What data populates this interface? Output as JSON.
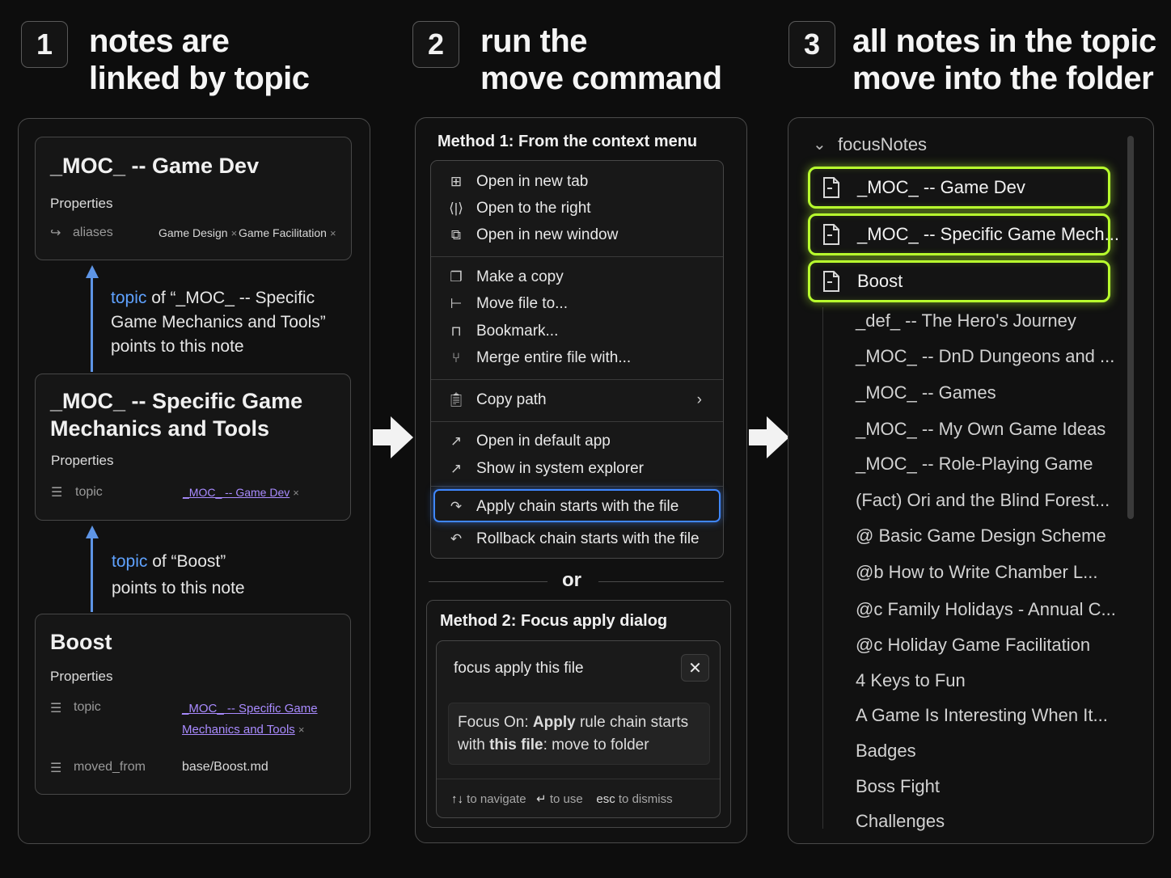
{
  "steps": [
    {
      "num": "1",
      "line1": "notes are",
      "line2": "linked by topic"
    },
    {
      "num": "2",
      "line1": "run the",
      "line2": "move command"
    },
    {
      "num": "3",
      "line1": "all notes in the topic",
      "line2": "move into the folder"
    }
  ],
  "panel1": {
    "card1": {
      "title": "_MOC_ -- Game Dev",
      "properties_label": "Properties",
      "prop_key": "aliases",
      "alias1": "Game Design",
      "alias2": "Game Facilitation",
      "remove": "×"
    },
    "note1": {
      "kw": "topic",
      "line1_rest": "of “_MOC_ -- Specific",
      "line2": "Game Mechanics and Tools”",
      "line3": "points to this note"
    },
    "card2": {
      "title_line1": "_MOC_ -- Specific Game",
      "title_line2": "Mechanics and Tools",
      "properties_label": "Properties",
      "prop_key": "topic",
      "prop_val": "_MOC_ -- Game Dev",
      "remove": "×"
    },
    "note2": {
      "kw": "topic",
      "line1_rest": "of “Boost”",
      "line2": "points to this note"
    },
    "card3": {
      "title": "Boost",
      "properties_label": "Properties",
      "prop1_key": "topic",
      "prop1_val_line1": "_MOC_ -- Specific Game",
      "prop1_val_line2": "Mechanics and Tools",
      "prop2_key": "moved_from",
      "prop2_val": "base/Boost.md",
      "remove": "×"
    }
  },
  "panel2": {
    "method1_title": "Method 1: From the context menu",
    "menu": [
      {
        "icon": "open-new-tab-icon",
        "label": "Open in new tab"
      },
      {
        "icon": "open-right-icon",
        "label": "Open to the right"
      },
      {
        "icon": "open-window-icon",
        "label": "Open in new window"
      },
      {
        "icon": "copy-icon",
        "label": "Make a copy"
      },
      {
        "icon": "move-file-icon",
        "label": "Move file to..."
      },
      {
        "icon": "bookmark-icon",
        "label": "Bookmark..."
      },
      {
        "icon": "merge-icon",
        "label": "Merge entire file with..."
      },
      {
        "icon": "clipboard-icon",
        "label": "Copy path"
      },
      {
        "icon": "external-link-icon",
        "label": "Open in default app"
      },
      {
        "icon": "external-link-icon",
        "label": "Show in system explorer"
      },
      {
        "icon": "redo-icon",
        "label": "Apply chain starts with the file"
      },
      {
        "icon": "undo-icon",
        "label": "Rollback chain starts with the file"
      }
    ],
    "or_label": "or",
    "method2_title": "Method 2: Focus apply dialog",
    "dialog": {
      "input_value": "focus apply this file",
      "close": "✕",
      "suggestion_p1": "Focus On: ",
      "suggestion_b1": "Apply",
      "suggestion_p2": " rule chain starts",
      "suggestion_p3": "with ",
      "suggestion_b2": "this file",
      "suggestion_p4": ": move to folder",
      "hint_nav_key": "↑↓",
      "hint_nav": "to navigate",
      "hint_use_key": "↵",
      "hint_use": "to use",
      "hint_esc_key": "esc",
      "hint_esc": "to dismiss"
    }
  },
  "panel3": {
    "folder": "focusNotes",
    "highlighted": [
      "_MOC_ -- Game Dev",
      "_MOC_ -- Specific Game Mech...",
      "Boost"
    ],
    "items": [
      "_def_ -- The Hero's Journey",
      "_MOC_ -- DnD Dungeons and ...",
      "_MOC_ -- Games",
      "_MOC_ -- My Own Game Ideas",
      "_MOC_ -- Role-Playing Game",
      "(Fact) Ori and the Blind Forest...",
      "@ Basic Game Design Scheme",
      "@b How to Write Chamber L...",
      "@c Family Holidays - Annual C...",
      "@c Holiday Game Facilitation",
      "4 Keys to Fun",
      "A Game Is Interesting When It...",
      "Badges",
      "Boss Fight",
      "Challenges"
    ]
  },
  "colors": {
    "highlight_green": "#b8ff2e",
    "highlight_blue": "#3f87ff",
    "link": "#a98bff",
    "keyword": "#5fa2ff"
  }
}
